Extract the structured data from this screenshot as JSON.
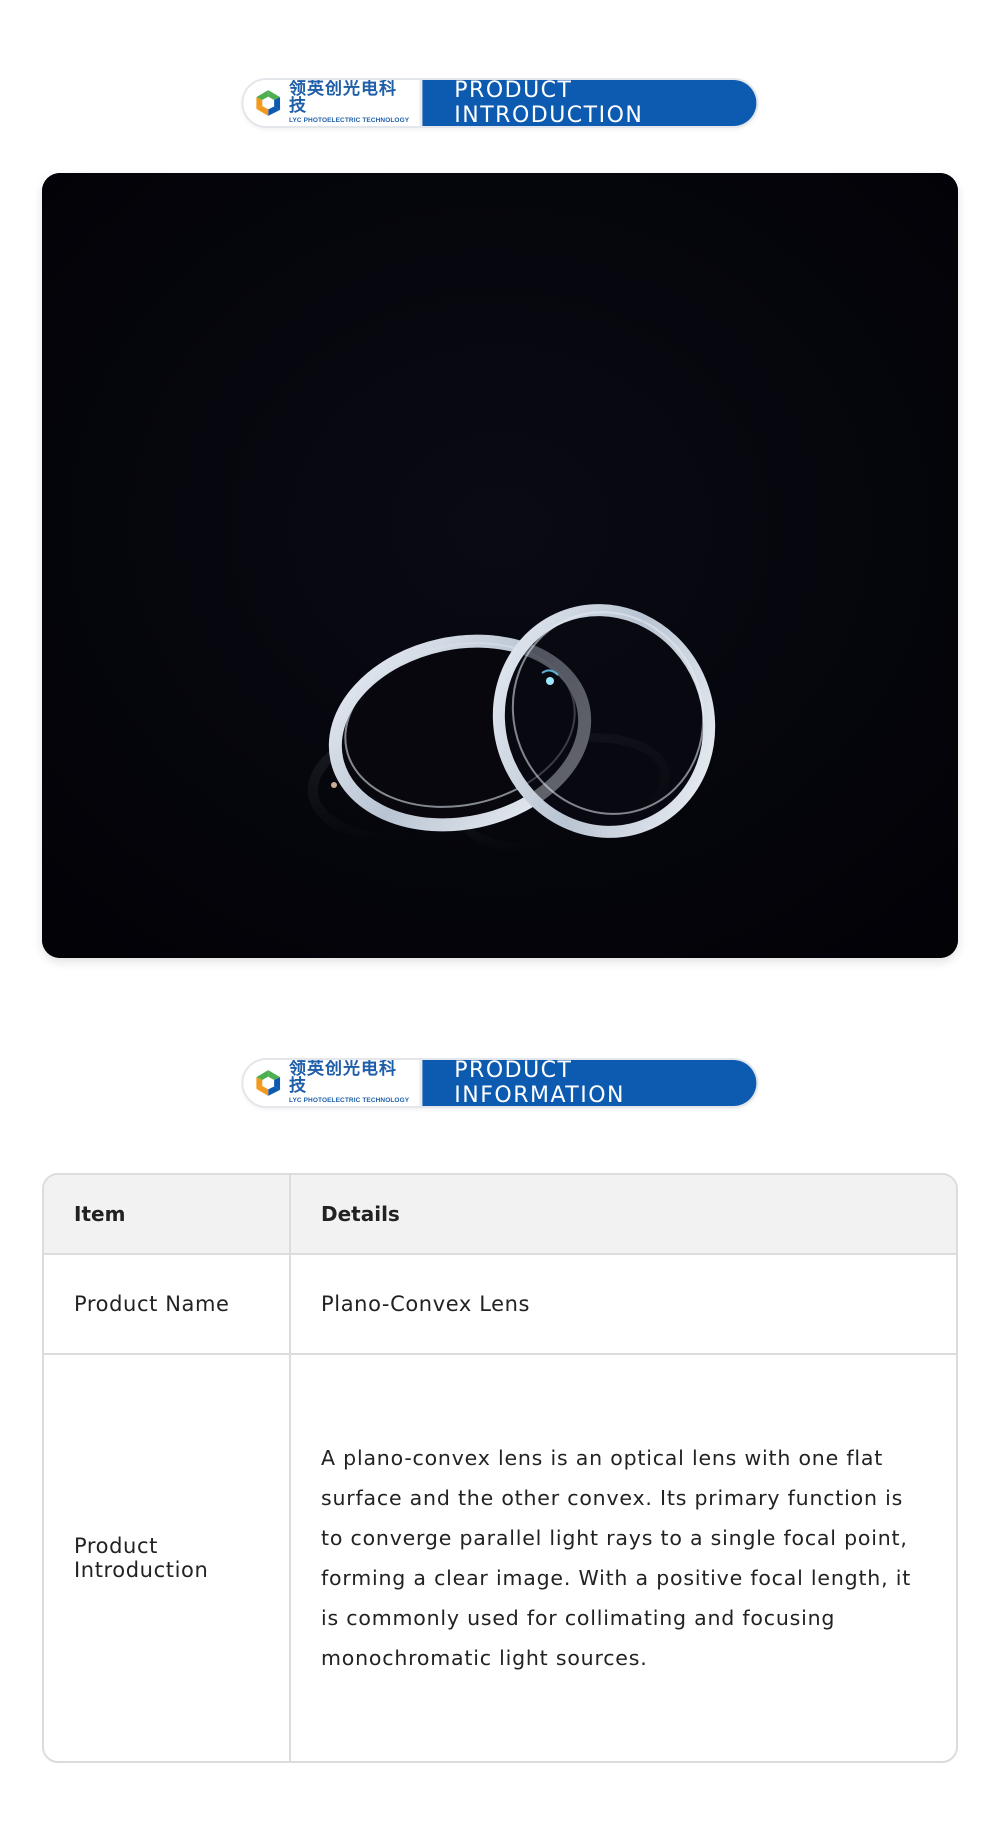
{
  "brand": {
    "name_cn": "领英创光电科技",
    "name_en": "LYC PHOTOELECTRIC TECHNOLOGY",
    "colors": {
      "blue": "#0c5bb0",
      "green": "#4caf50",
      "orange": "#f39a1e",
      "logo_blue": "#1f5fa8"
    }
  },
  "sections": {
    "intro_title": "PRODUCT INTRODUCTION",
    "info_title": "PRODUCT INFORMATION"
  },
  "hero": {
    "icon": "plano-convex-lens-photo"
  },
  "table": {
    "headers": [
      "Item",
      "Details"
    ],
    "rows": [
      {
        "item": "Product Name",
        "details": "Plano-Convex Lens"
      },
      {
        "item": "Product Introduction",
        "details": "A plano-convex lens is an optical lens with one flat surface and the other convex. Its primary function is to converge parallel light rays to a single focal point, forming a clear image. With a positive focal length, it is commonly used for collimating and focusing monochromatic light sources."
      }
    ]
  }
}
